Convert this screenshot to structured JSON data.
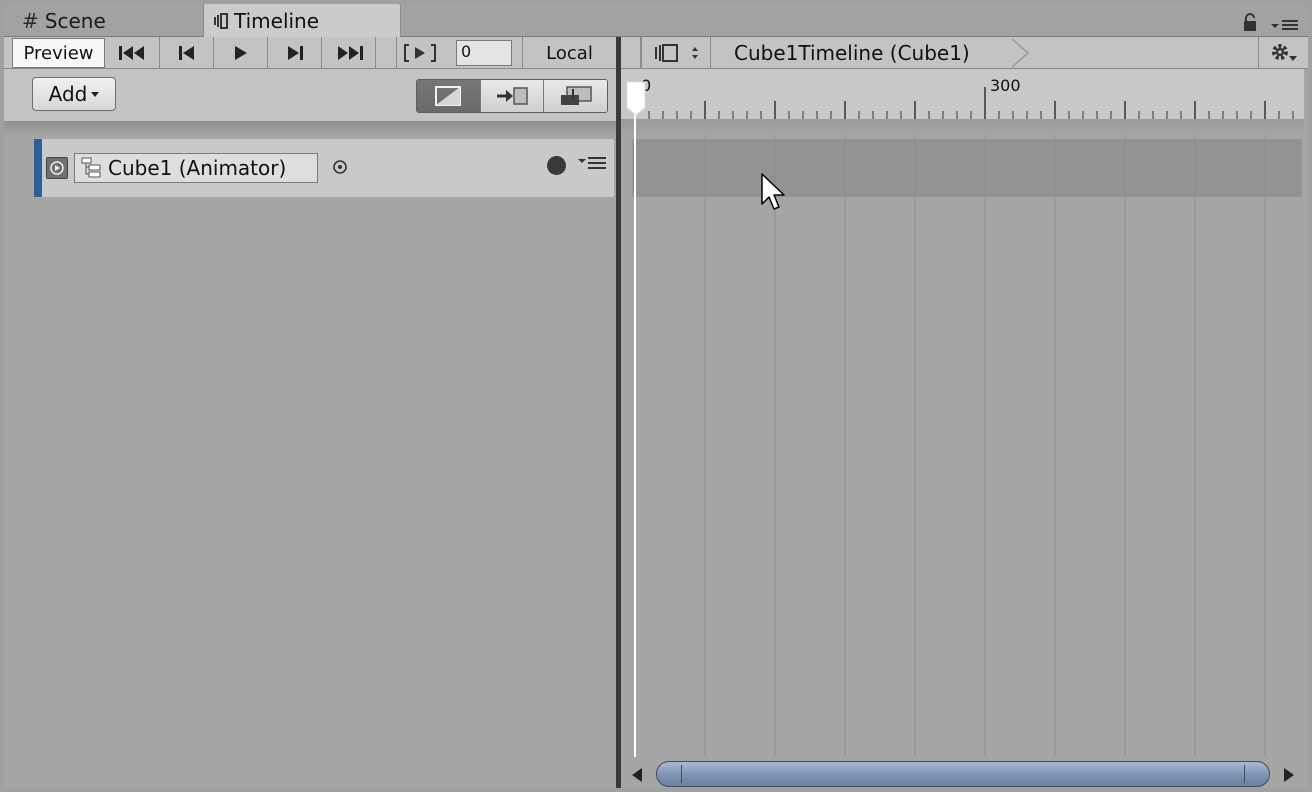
{
  "window_tabs": [
    {
      "label": "Scene",
      "icon": "hash-icon",
      "active": false
    },
    {
      "label": "Timeline",
      "icon": "timeline-icon",
      "active": true
    }
  ],
  "toolbar": {
    "preview_label": "Preview",
    "frame_value": "0",
    "local_label": "Local",
    "transport_icons": [
      "first-frame-icon",
      "previous-frame-icon",
      "play-icon",
      "next-frame-icon",
      "last-frame-icon",
      "play-range-icon"
    ]
  },
  "track_panel": {
    "add_label": "Add",
    "edit_modes": [
      "mix-mode-icon",
      "ripple-mode-icon",
      "replace-mode-icon"
    ],
    "tracks": [
      {
        "binding_label": "Cube1 (Animator)",
        "color": "#2c5f94",
        "type": "animation-track"
      }
    ]
  },
  "timeline": {
    "breadcrumb": "Cube1Timeline (Cube1)",
    "ruler_labels": [
      "0",
      "300"
    ],
    "playhead_frame": 0
  },
  "colors": {
    "track_accent": "#2c5f94",
    "scrollbar_thumb": "#8a9dbb",
    "playhead": "#ffffff"
  }
}
